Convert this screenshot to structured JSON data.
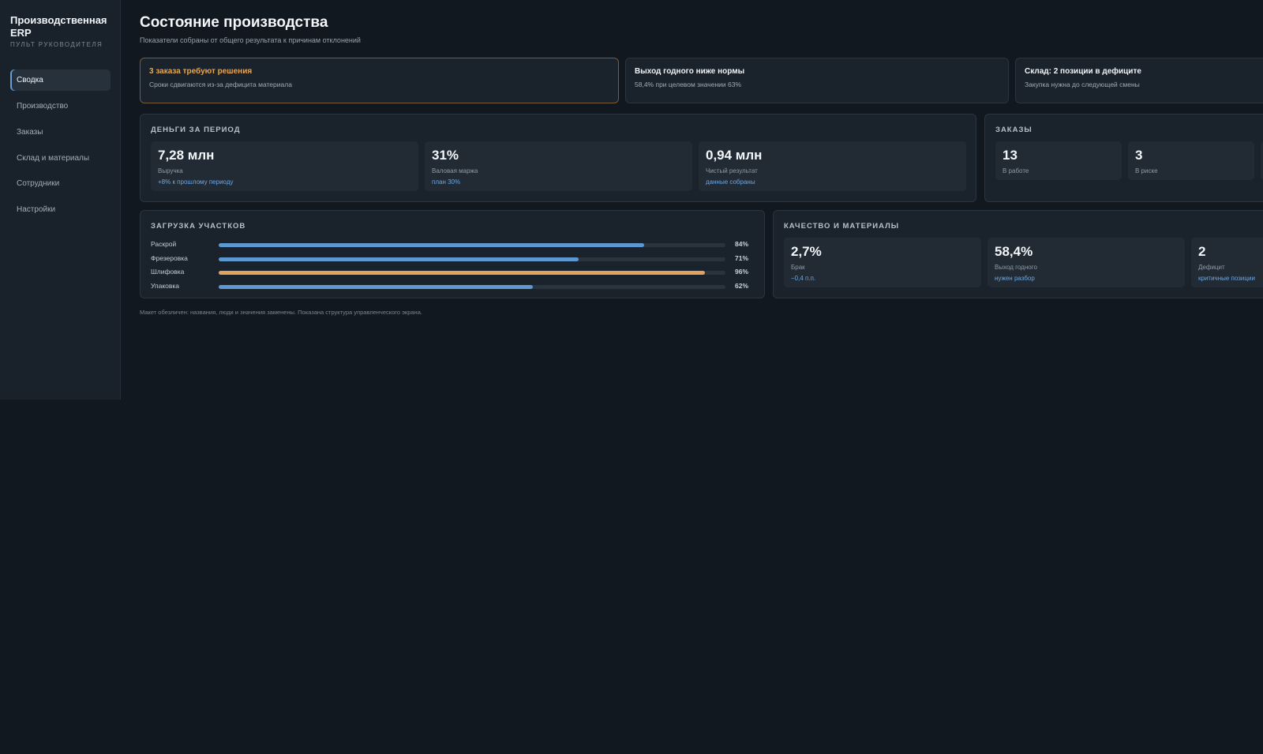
{
  "sidebar": {
    "brand_title": "Производственная ERP",
    "brand_subtitle": "ПУЛЬТ РУКОВОДИТЕЛЯ",
    "items": [
      {
        "label": "Сводка",
        "active": true
      },
      {
        "label": "Производство"
      },
      {
        "label": "Заказы"
      },
      {
        "label": "Склад и материалы"
      },
      {
        "label": "Сотрудники"
      },
      {
        "label": "Настройки"
      }
    ]
  },
  "header": {
    "title": "Состояние производства",
    "subtitle": "Показатели собраны от общего результата к причинам отклонений"
  },
  "alerts": [
    {
      "title": "3 заказа требуют решения",
      "text": "Сроки сдвигаются из-за дефицита материала",
      "level": "warning"
    },
    {
      "title": "Выход годного ниже нормы",
      "text": "58,4% при целевом значении 63%"
    },
    {
      "title": "Склад: 2 позиции в дефиците",
      "text": "Закупка нужна до следующей смены"
    }
  ],
  "money": {
    "title": "ДЕНЬГИ ЗА ПЕРИОД",
    "metrics": [
      {
        "value": "7,28 млн",
        "label": "Выручка",
        "note": "+8% к прошлому периоду"
      },
      {
        "value": "31%",
        "label": "Валовая маржа",
        "note": "план 30%"
      },
      {
        "value": "0,94 млн",
        "label": "Чистый результат",
        "note": "данные собраны"
      }
    ]
  },
  "orders": {
    "title": "ЗАКАЗЫ",
    "metrics": [
      {
        "value": "13",
        "label": "В работе"
      },
      {
        "value": "3",
        "label": "В риске"
      }
    ]
  },
  "load": {
    "title": "ЗАГРУЗКА УЧАСТКОВ",
    "rows": [
      {
        "name": "Раскрой",
        "value": 84,
        "label": "84%"
      },
      {
        "name": "Фрезеровка",
        "value": 71,
        "label": "71%"
      },
      {
        "name": "Шлифовка",
        "value": 96,
        "label": "96%",
        "warn": true
      },
      {
        "name": "Упаковка",
        "value": 62,
        "label": "62%"
      }
    ]
  },
  "quality": {
    "title": "КАЧЕСТВО И МАТЕРИАЛЫ",
    "metrics": [
      {
        "value": "2,7%",
        "label": "Брак",
        "note": "−0,4 п.п."
      },
      {
        "value": "58,4%",
        "label": "Выход годного",
        "note": "нужен разбор"
      },
      {
        "value": "2",
        "label": "Дефицит",
        "note": "критичные позиции"
      }
    ]
  },
  "footnote": "Макет обезличен: названия, люди и значения заменены. Показана структура управленческого экрана.",
  "colors": {
    "accent": "#5d98d3",
    "warning": "#e0a25c",
    "background": "#111820"
  }
}
